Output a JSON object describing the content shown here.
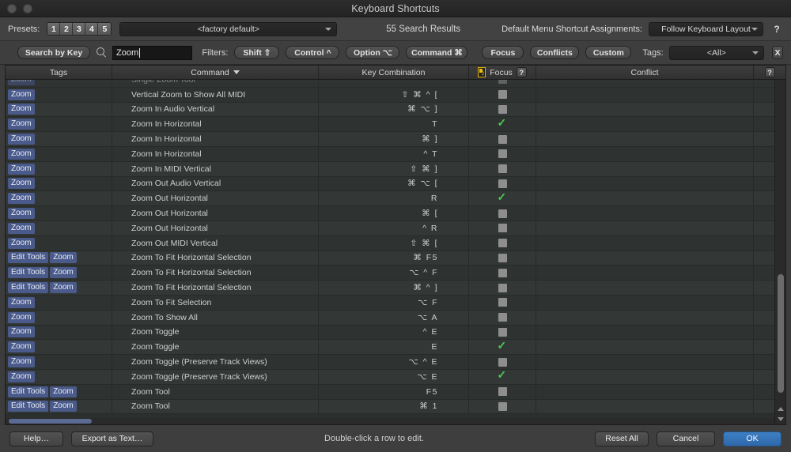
{
  "window": {
    "title": "Keyboard Shortcuts"
  },
  "presets_bar": {
    "presets_label": "Presets:",
    "preset_buttons": [
      "1",
      "2",
      "3",
      "4",
      "5"
    ],
    "preset_selected": "<factory default>",
    "search_results": "55 Search Results",
    "default_menu_label": "Default Menu Shortcut Assignments:",
    "default_menu_value": "Follow Keyboard Layout",
    "help_icon": "question-mark-icon",
    "help_label": "?"
  },
  "filter_bar": {
    "search_by_key": "Search by Key",
    "search_icon": "search-icon",
    "search_value": "Zoom",
    "search_placeholder": "",
    "filters_label": "Filters:",
    "filters": [
      "Shift ⇧",
      "Control ^",
      "Option ⌥",
      "Command ⌘"
    ],
    "toggles": [
      "Focus",
      "Conflicts",
      "Custom"
    ],
    "tags_label": "Tags:",
    "tags_value": "<All>",
    "clear_label": "X"
  },
  "table": {
    "columns": {
      "tags": "Tags",
      "command": "Command",
      "command_sort": "▼",
      "key_combination": "Key Combination",
      "focus": "Focus",
      "focus_icon": "keyboard-focus-icon",
      "focus_help": "?",
      "conflict": "Conflict",
      "conflict_help": "?"
    },
    "clipped_row": {
      "tags": [
        "Zoom"
      ],
      "command": "Single Zoom Tool",
      "key": "",
      "focus": false
    },
    "rows": [
      {
        "tags": [
          "Zoom"
        ],
        "command": "Vertical Zoom to Show All MIDI",
        "key": "⇧ ⌘ ^ [",
        "focus": false,
        "conflict": ""
      },
      {
        "tags": [
          "Zoom"
        ],
        "command": "Zoom In Audio Vertical",
        "key": "⌘ ⌥ ]",
        "focus": false,
        "conflict": ""
      },
      {
        "tags": [
          "Zoom"
        ],
        "command": "Zoom In Horizontal",
        "key": "T",
        "focus": true,
        "conflict": ""
      },
      {
        "tags": [
          "Zoom"
        ],
        "command": "Zoom In Horizontal",
        "key": "⌘ ]",
        "focus": false,
        "conflict": ""
      },
      {
        "tags": [
          "Zoom"
        ],
        "command": "Zoom In Horizontal",
        "key": "^ T",
        "focus": false,
        "conflict": ""
      },
      {
        "tags": [
          "Zoom"
        ],
        "command": "Zoom In MIDI Vertical",
        "key": "⇧ ⌘ ]",
        "focus": false,
        "conflict": ""
      },
      {
        "tags": [
          "Zoom"
        ],
        "command": "Zoom Out Audio Vertical",
        "key": "⌘ ⌥ [",
        "focus": false,
        "conflict": ""
      },
      {
        "tags": [
          "Zoom"
        ],
        "command": "Zoom Out Horizontal",
        "key": "R",
        "focus": true,
        "conflict": ""
      },
      {
        "tags": [
          "Zoom"
        ],
        "command": "Zoom Out Horizontal",
        "key": "⌘ [",
        "focus": false,
        "conflict": ""
      },
      {
        "tags": [
          "Zoom"
        ],
        "command": "Zoom Out Horizontal",
        "key": "^ R",
        "focus": false,
        "conflict": ""
      },
      {
        "tags": [
          "Zoom"
        ],
        "command": "Zoom Out MIDI Vertical",
        "key": "⇧ ⌘ [",
        "focus": false,
        "conflict": ""
      },
      {
        "tags": [
          "Edit Tools",
          "Zoom"
        ],
        "command": "Zoom To Fit Horizontal Selection",
        "key": "⌘ F5",
        "focus": false,
        "conflict": ""
      },
      {
        "tags": [
          "Edit Tools",
          "Zoom"
        ],
        "command": "Zoom To Fit Horizontal Selection",
        "key": "⌥ ^ F",
        "focus": false,
        "conflict": ""
      },
      {
        "tags": [
          "Edit Tools",
          "Zoom"
        ],
        "command": "Zoom To Fit Horizontal Selection",
        "key": "⌘ ^ ]",
        "focus": false,
        "conflict": ""
      },
      {
        "tags": [
          "Zoom"
        ],
        "command": "Zoom To Fit Selection",
        "key": "⌥ F",
        "focus": false,
        "conflict": ""
      },
      {
        "tags": [
          "Zoom"
        ],
        "command": "Zoom To Show All",
        "key": "⌥ A",
        "focus": false,
        "conflict": ""
      },
      {
        "tags": [
          "Zoom"
        ],
        "command": "Zoom Toggle",
        "key": "^ E",
        "focus": false,
        "conflict": ""
      },
      {
        "tags": [
          "Zoom"
        ],
        "command": "Zoom Toggle",
        "key": "E",
        "focus": true,
        "conflict": ""
      },
      {
        "tags": [
          "Zoom"
        ],
        "command": "Zoom Toggle (Preserve Track Views)",
        "key": "⌥ ^ E",
        "focus": false,
        "conflict": ""
      },
      {
        "tags": [
          "Zoom"
        ],
        "command": "Zoom Toggle (Preserve Track Views)",
        "key": "⌥ E",
        "focus": true,
        "conflict": ""
      },
      {
        "tags": [
          "Edit Tools",
          "Zoom"
        ],
        "command": "Zoom Tool",
        "key": "F5",
        "focus": false,
        "conflict": ""
      },
      {
        "tags": [
          "Edit Tools",
          "Zoom"
        ],
        "command": "Zoom Tool",
        "key": "⌘ 1",
        "focus": false,
        "conflict": ""
      }
    ]
  },
  "footer": {
    "help": "Help…",
    "export": "Export as Text…",
    "hint": "Double-click a row to edit.",
    "reset_all": "Reset All",
    "cancel": "Cancel",
    "ok": "OK"
  }
}
